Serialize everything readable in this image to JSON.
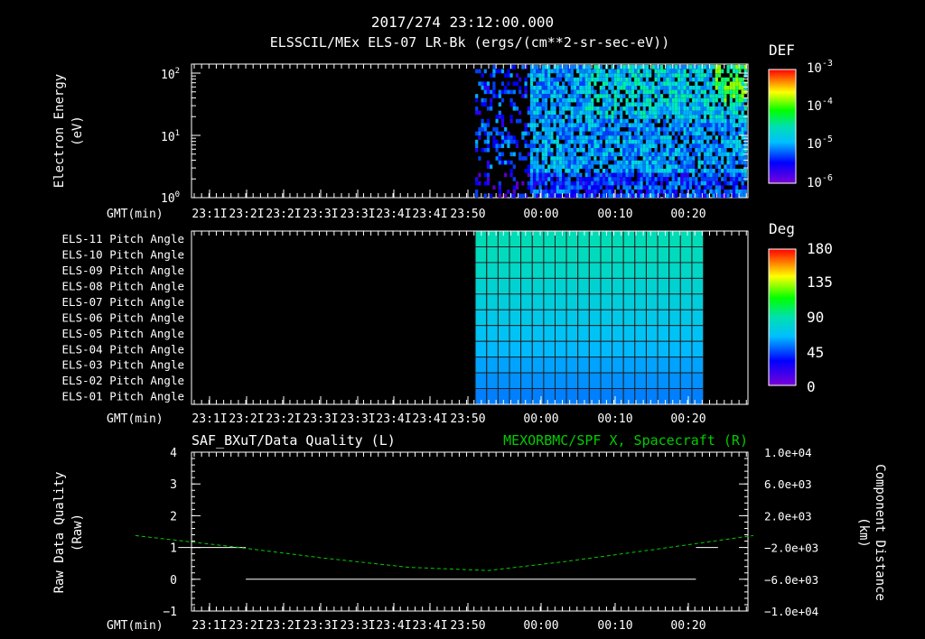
{
  "header": {
    "timestamp": "2017/274 23:12:00.000",
    "title": "ELSSCIL/MEx ELS-07 LR-Bk  (ergs/(cm**2-sr-sec-eV))"
  },
  "chart_data": [
    {
      "type": "heatmap",
      "name": "energy-spectrogram",
      "ylabel": "Electron Energy",
      "ylabel_units": "(eV)",
      "y_scale": "log",
      "ylim": [
        1,
        150
      ],
      "y_ticks": [
        {
          "value": 1,
          "base": "10",
          "exp": "0"
        },
        {
          "value": 10,
          "base": "10",
          "exp": "1"
        },
        {
          "value": 100,
          "base": "10",
          "exp": "2"
        }
      ],
      "xlabel": "GMT(min)",
      "x_ticks": [
        "23:1І",
        "23:2І",
        "23:2І",
        "23:3І",
        "23:3І",
        "23:4І",
        "23:4І",
        "23:50",
        "00:00",
        "00:10",
        "00:20"
      ],
      "colorbar": {
        "label": "DEF",
        "scale": "log",
        "ticks": [
          {
            "base": "10",
            "exp": "-3"
          },
          {
            "base": "10",
            "exp": "-4"
          },
          {
            "base": "10",
            "exp": "-5"
          },
          {
            "base": "10",
            "exp": "-6"
          }
        ]
      },
      "data_time_range": [
        "23:51",
        "00:28"
      ]
    },
    {
      "type": "heatmap",
      "name": "pitch-angle",
      "channels": [
        "ELS-11 Pitch Angle",
        "ELS-10 Pitch Angle",
        "ELS-09 Pitch Angle",
        "ELS-08 Pitch Angle",
        "ELS-07 Pitch Angle",
        "ELS-06 Pitch Angle",
        "ELS-05 Pitch Angle",
        "ELS-04 Pitch Angle",
        "ELS-03 Pitch Angle",
        "ELS-02 Pitch Angle",
        "ELS-01 Pitch Angle"
      ],
      "channel_values_deg": [
        88,
        86,
        83,
        79,
        76,
        72,
        68,
        64,
        60,
        57,
        54
      ],
      "xlabel": "GMT(min)",
      "x_ticks": [
        "23:1І",
        "23:2І",
        "23:2І",
        "23:3І",
        "23:3І",
        "23:4І",
        "23:4І",
        "23:50",
        "00:00",
        "00:10",
        "00:20"
      ],
      "colorbar": {
        "label": "Deg",
        "ticks": [
          "180",
          "135",
          "90",
          "45",
          "0"
        ]
      },
      "data_time_range": [
        "23:51",
        "00:22"
      ]
    },
    {
      "type": "line",
      "name": "data-quality-position",
      "title_left": "SAF_BXuT/Data Quality (L)",
      "title_right": "MEXORBMC/SPF X, Spacecraft (R)",
      "ylabel_left": "Raw Data Quality",
      "ylabel_left_units": "(Raw)",
      "ylabel_right": "Component Distance",
      "ylabel_right_units": "(km)",
      "left_ticks": [
        "4",
        "3",
        "2",
        "1",
        "0",
        "−1"
      ],
      "right_ticks": [
        "1.0e+04",
        "6.0e+03",
        "2.0e+03",
        "−2.0e+03",
        "−6.0e+03",
        "−1.0e+04"
      ],
      "ylim_left": [
        -1,
        4
      ],
      "ylim_right": [
        -10000,
        10000
      ],
      "xlabel": "GMT(min)",
      "x_ticks": [
        "23:1І",
        "23:2І",
        "23:2І",
        "23:3І",
        "23:3І",
        "23:4І",
        "23:4І",
        "23:50",
        "00:00",
        "00:10",
        "00:20"
      ],
      "series": [
        {
          "name": "SAF_BXuT/Data Quality",
          "color": "#ffffff",
          "segments": [
            {
              "x": [
                23.177,
                23.33
              ],
              "y": [
                1,
                1
              ]
            },
            {
              "x": [
                23.33,
                24.35
              ],
              "y": [
                0,
                0
              ]
            },
            {
              "x": [
                24.35,
                24.4
              ],
              "y": [
                1,
                1
              ]
            }
          ]
        },
        {
          "name": "MEXORBMC/SPF X, Spacecraft",
          "color": "#00cc00",
          "axis": "right",
          "x": [
            23.08,
            23.3,
            23.5,
            23.7,
            23.88,
            24.05,
            24.25,
            24.48
          ],
          "y": [
            -500,
            -1900,
            -3300,
            -4500,
            -4900,
            -3800,
            -2300,
            -500
          ]
        }
      ]
    }
  ]
}
